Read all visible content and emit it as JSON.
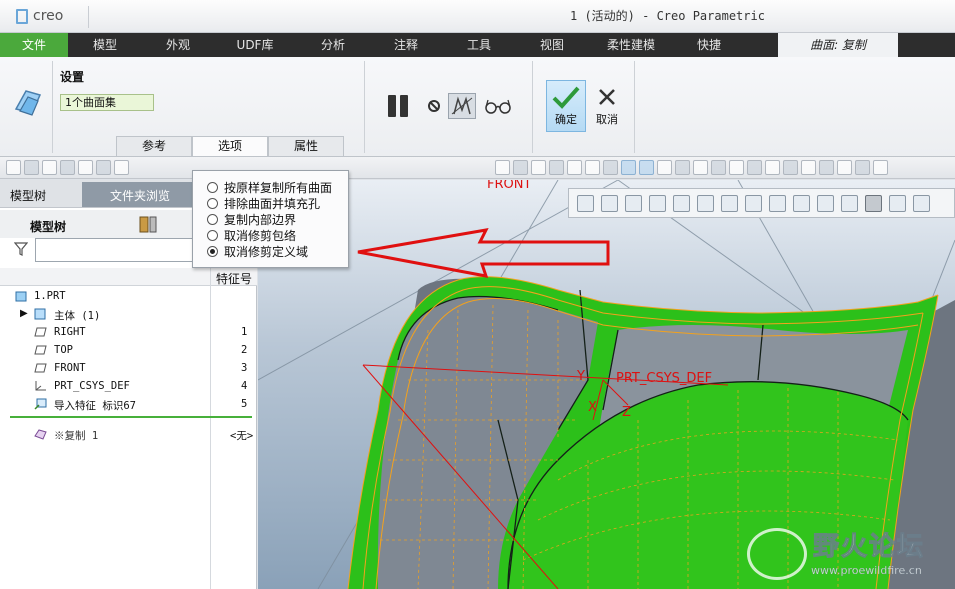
{
  "app": {
    "logo_text": "creo",
    "window_title": "1 (活动的) - Creo Parametric"
  },
  "ribbon_tabs": [
    {
      "label": "文件"
    },
    {
      "label": "模型"
    },
    {
      "label": "外观"
    },
    {
      "label": "UDF库"
    },
    {
      "label": "分析"
    },
    {
      "label": "注释"
    },
    {
      "label": "工具"
    },
    {
      "label": "视图"
    },
    {
      "label": "柔性建模"
    },
    {
      "label": "快捷"
    },
    {
      "label": "曲面: 复制"
    }
  ],
  "ribbon": {
    "settings_label": "设置",
    "collection_value": "1个曲面集",
    "panel_tabs": [
      "参考",
      "选项",
      "属性"
    ],
    "ok_label": "确定",
    "cancel_label": "取消"
  },
  "options_popup": {
    "items": [
      {
        "label": "按原样复制所有曲面",
        "selected": false
      },
      {
        "label": "排除曲面并填充孔",
        "selected": false
      },
      {
        "label": "复制内部边界",
        "selected": false
      },
      {
        "label": "取消修剪包络",
        "selected": false
      },
      {
        "label": "取消修剪定义域",
        "selected": true
      }
    ]
  },
  "left_panel": {
    "tab_model_tree": "模型树",
    "tab_folder_browser": "文件夹浏览",
    "tree_title": "模型树",
    "column_feature_id": "特征号",
    "rows": [
      {
        "label": "1.PRT",
        "num": ""
      },
      {
        "label": "主体 (1)",
        "num": ""
      },
      {
        "label": "RIGHT",
        "num": "1"
      },
      {
        "label": "TOP",
        "num": "2"
      },
      {
        "label": "FRONT",
        "num": "3"
      },
      {
        "label": "PRT_CSYS_DEF",
        "num": "4"
      },
      {
        "label": "导入特征 标识67",
        "num": "5"
      },
      {
        "label": "复制 1",
        "num": "<无>"
      }
    ]
  },
  "graphics": {
    "plane_label": "FRONT",
    "csys_label": "PRT_CSYS_DEF",
    "axis_x": "X",
    "axis_y": "Y",
    "axis_z": "Z"
  },
  "watermark": {
    "text": "野火论坛",
    "url": "www.proewildfire.cn"
  },
  "colors": {
    "file_tab": "#4ba93c",
    "surface_green": "#2fc219",
    "edge_orange": "#f0a020",
    "arrow_red": "#e01010"
  }
}
